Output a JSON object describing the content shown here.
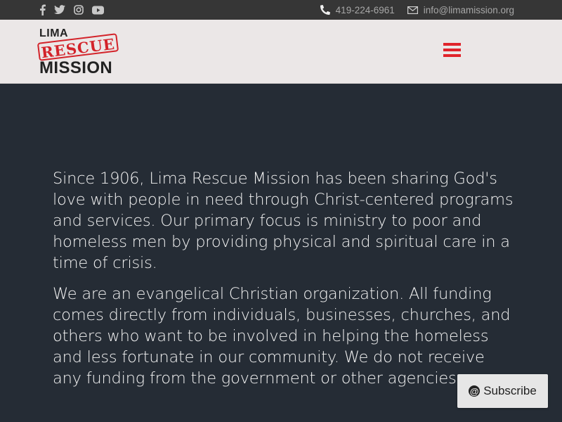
{
  "topbar": {
    "social_icons": [
      "facebook-icon",
      "twitter-icon",
      "instagram-icon",
      "youtube-icon"
    ],
    "phone": "419-224-6961",
    "email": "info@limamission.org"
  },
  "header": {
    "logo": {
      "line1": "LIMA",
      "stamp": "RESCUE",
      "line2": "MISSION"
    },
    "menu_icon": "hamburger-icon"
  },
  "main": {
    "paragraphs": [
      "Since 1906, Lima Rescue Mission has been sharing God's love with people in need through Christ-centered programs and services. Our primary focus is ministry to poor and homeless men by providing physical and spiritual care in a time of crisis.",
      "We are an evangelical Christian organization. All funding comes directly from individuals, businesses, churches, and others who want to be involved in helping the homeless and less fortunate in our community. We do not receive any funding from the government or other agencies."
    ]
  },
  "subscribe": {
    "label": "Subscribe",
    "icon": "at-icon"
  },
  "colors": {
    "topbar_bg": "#363636",
    "header_bg": "#ebe7e7",
    "body_bg": "#252c35",
    "accent_red": "#e0242b",
    "text_light": "#f3f3f3"
  }
}
